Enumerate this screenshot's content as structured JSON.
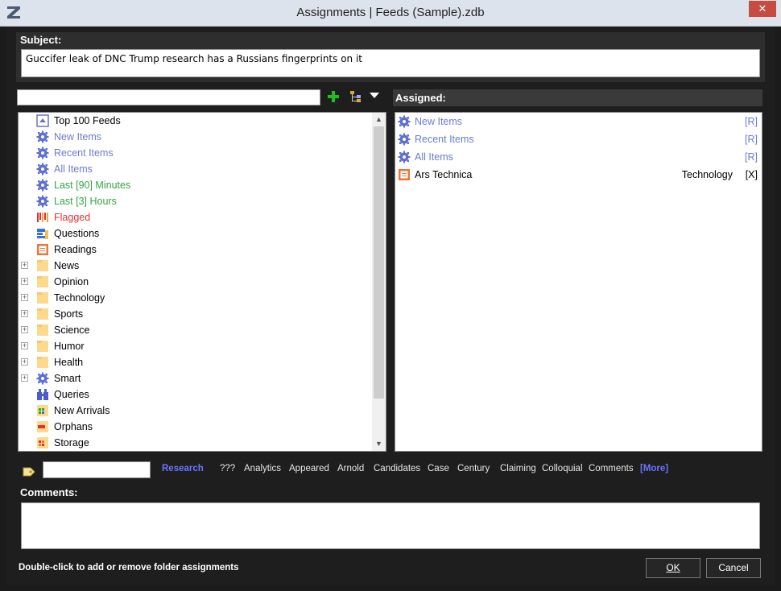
{
  "window": {
    "title": "Assignments  |  Feeds (Sample).zdb",
    "close_label": "✕"
  },
  "subject": {
    "label": "Subject:",
    "value": "Guccifer leak of DNC Trump research has a Russians fingerprints on it"
  },
  "tree": {
    "items": [
      {
        "label": "Top 100 Feeds",
        "icon": "top-feeds-icon",
        "color": "#000000",
        "expandable": false
      },
      {
        "label": "New Items",
        "icon": "gear-icon",
        "color": "#6b7ad6",
        "expandable": false
      },
      {
        "label": "Recent Items",
        "icon": "gear-icon",
        "color": "#6b7ad6",
        "expandable": false
      },
      {
        "label": "All Items",
        "icon": "gear-icon",
        "color": "#6b7ad6",
        "expandable": false
      },
      {
        "label": "Last [90] Minutes",
        "icon": "gear-icon",
        "color": "#36a346",
        "expandable": false
      },
      {
        "label": "Last [3] Hours",
        "icon": "gear-icon",
        "color": "#36a346",
        "expandable": false
      },
      {
        "label": "Flagged",
        "icon": "flag-icon",
        "color": "#e23030",
        "expandable": false
      },
      {
        "label": "Questions",
        "icon": "questions-icon",
        "color": "#000000",
        "expandable": false
      },
      {
        "label": "Readings",
        "icon": "readings-icon",
        "color": "#000000",
        "expandable": false
      },
      {
        "label": "News",
        "icon": "folder-icon",
        "color": "#000000",
        "expandable": true
      },
      {
        "label": "Opinion",
        "icon": "folder-icon",
        "color": "#000000",
        "expandable": true
      },
      {
        "label": "Technology",
        "icon": "folder-icon",
        "color": "#000000",
        "expandable": true
      },
      {
        "label": "Sports",
        "icon": "folder-icon",
        "color": "#000000",
        "expandable": true
      },
      {
        "label": "Science",
        "icon": "folder-icon",
        "color": "#000000",
        "expandable": true
      },
      {
        "label": "Humor",
        "icon": "folder-icon",
        "color": "#000000",
        "expandable": true
      },
      {
        "label": "Health",
        "icon": "folder-icon",
        "color": "#000000",
        "expandable": true
      },
      {
        "label": "Smart",
        "icon": "gear-icon",
        "color": "#000000",
        "expandable": true
      },
      {
        "label": "Queries",
        "icon": "binoculars-icon",
        "color": "#000000",
        "expandable": false
      },
      {
        "label": "New Arrivals",
        "icon": "new-arrivals-icon",
        "color": "#000000",
        "expandable": false
      },
      {
        "label": "Orphans",
        "icon": "orphans-icon",
        "color": "#000000",
        "expandable": false
      },
      {
        "label": "Storage",
        "icon": "storage-icon",
        "color": "#000000",
        "expandable": false
      }
    ]
  },
  "assigned": {
    "label": "Assigned:",
    "items": [
      {
        "label": "New Items",
        "category": "",
        "tag": "[R]",
        "icon": "gear-icon",
        "color": "#6b7ad6",
        "tag_color": "#6b7ad6"
      },
      {
        "label": "Recent Items",
        "category": "",
        "tag": "[R]",
        "icon": "gear-icon",
        "color": "#6b7ad6",
        "tag_color": "#6b7ad6"
      },
      {
        "label": "All Items",
        "category": "",
        "tag": "[R]",
        "icon": "gear-icon",
        "color": "#6b7ad6",
        "tag_color": "#6b7ad6"
      },
      {
        "label": "Ars Technica",
        "category": "Technology",
        "tag": "[X]",
        "icon": "readings-icon",
        "color": "#000000",
        "tag_color": "#000000"
      }
    ]
  },
  "tags": {
    "research": "Research",
    "links": [
      "???",
      "Analytics",
      "Appeared",
      "Arnold",
      "Candidates",
      "Case",
      "Century",
      "Claiming",
      "Colloquial",
      "Comments"
    ],
    "more": "[More]"
  },
  "comments": {
    "label": "Comments:"
  },
  "status": "Double-click to add or remove folder assignments",
  "buttons": {
    "ok": "OK",
    "cancel": "Cancel"
  }
}
